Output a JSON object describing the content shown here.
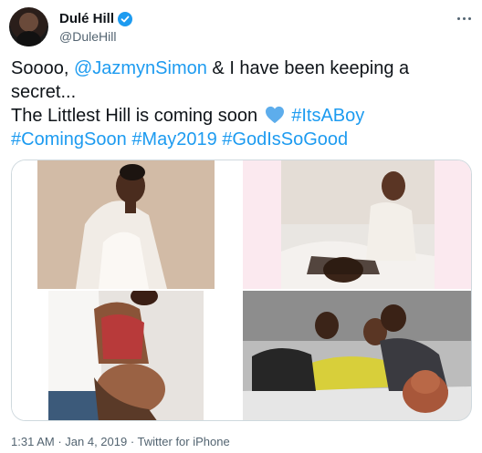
{
  "author": {
    "name": "Dulé Hill",
    "handle": "@DuleHill",
    "verified_icon": "verified-badge-icon",
    "badge_color": "#1d9bf0"
  },
  "tweet": {
    "line1_pre": "Soooo, ",
    "line1_mention": "@JazmynSimon",
    "line1_post": " & I have been keeping a",
    "line2": "secret...",
    "line3_pre": "The Littlest Hill is coming soon ",
    "heart_icon": "blue-heart-icon",
    "line3_tag": "#ItsABoy",
    "tag1": "#ComingSoon",
    "tag2": "#May2019",
    "tag3": "#GodIsSoGood",
    "link_color": "#1d9bf0"
  },
  "media": {
    "photos": [
      "photo-1",
      "photo-2",
      "photo-3",
      "photo-4"
    ]
  },
  "meta": {
    "time": "1:31 AM",
    "sep1": " · ",
    "date": "Jan 4, 2019",
    "sep2": " · ",
    "source": "Twitter for iPhone"
  }
}
